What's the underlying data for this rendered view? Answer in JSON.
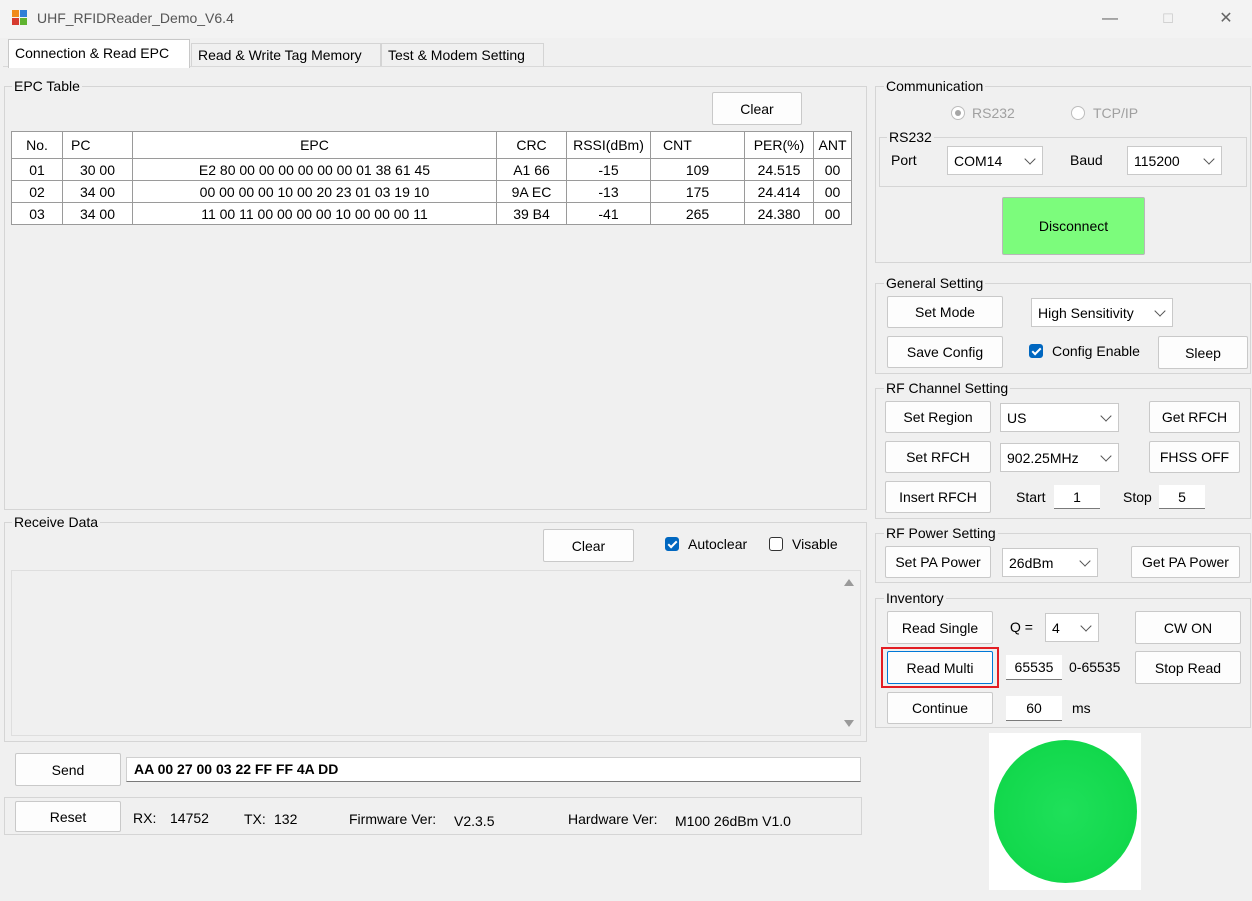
{
  "window": {
    "title": "UHF_RFIDReader_Demo_V6.4",
    "controls": [
      "—",
      "☐",
      "✕"
    ]
  },
  "tabs": [
    "Connection & Read EPC",
    "Read & Write Tag Memory",
    "Test & Modem Setting"
  ],
  "epc_table": {
    "group_label": "EPC Table",
    "clear_label": "Clear",
    "columns": [
      "No.",
      "PC",
      "EPC",
      "CRC",
      "RSSI(dBm)",
      "CNT",
      "PER(%)",
      "ANT"
    ],
    "rows": [
      [
        "01",
        "30 00",
        "E2 80 00 00 00 00 00 00 01 38 61 45",
        "A1 66",
        "-15",
        "109",
        "24.515",
        "00"
      ],
      [
        "02",
        "34 00",
        "00 00 00 00 10 00 20 23 01 03 19 10",
        "9A EC",
        "-13",
        "175",
        "24.414",
        "00"
      ],
      [
        "03",
        "34 00",
        "11 00 11 00 00 00 00 10 00 00 00 11",
        "39 B4",
        "-41",
        "265",
        "24.380",
        "00"
      ]
    ]
  },
  "receive": {
    "group_label": "Receive Data",
    "clear_label": "Clear",
    "autoclear_label": "Autoclear",
    "visable_label": "Visable",
    "autoclear_checked": true,
    "visable_checked": false,
    "send_label": "Send",
    "send_value": "AA 00 27 00 03 22 FF FF 4A DD"
  },
  "status": {
    "reset_label": "Reset",
    "rx_label": "RX:",
    "rx_value": "14752",
    "tx_label": "TX:",
    "tx_value": "132",
    "fw_label": "Firmware Ver:",
    "fw_value": "V2.3.5",
    "hw_label": "Hardware Ver:",
    "hw_value": "M100 26dBm V1.0"
  },
  "communication": {
    "group_label": "Communication",
    "radio_rs232": "RS232",
    "radio_tcpip": "TCP/IP",
    "selected": "RS232",
    "rs232_label": "RS232",
    "port_label": "Port",
    "port_value": "COM14",
    "baud_label": "Baud",
    "baud_value": "115200",
    "disconnect_label": "Disconnect",
    "disconnect_color": "#7cfc7c"
  },
  "general": {
    "group_label": "General Setting",
    "set_mode_label": "Set Mode",
    "mode_value": "High Sensitivity",
    "save_config_label": "Save Config",
    "config_enable_label": "Config Enable",
    "config_enable_checked": true,
    "sleep_label": "Sleep"
  },
  "rf_channel": {
    "group_label": "RF Channel Setting",
    "set_region_label": "Set Region",
    "region_value": "US",
    "get_rfch_label": "Get RFCH",
    "set_rfch_label": "Set RFCH",
    "rfch_value": "902.25MHz",
    "fhss_label": "FHSS OFF",
    "insert_rfch_label": "Insert RFCH",
    "start_label": "Start",
    "start_value": "1",
    "stop_label": "Stop",
    "stop_value": "5"
  },
  "rf_power": {
    "group_label": "RF Power Setting",
    "set_pa_label": "Set PA Power",
    "pa_value": "26dBm",
    "get_pa_label": "Get PA Power"
  },
  "inventory": {
    "group_label": "Inventory",
    "read_single_label": "Read Single",
    "q_label": "Q =",
    "q_value": "4",
    "cw_on_label": "CW ON",
    "read_multi_label": "Read Multi",
    "count_value": "65535",
    "count_range": "0-65535",
    "stop_read_label": "Stop Read",
    "continue_label": "Continue",
    "interval_value": "60",
    "interval_unit": "ms"
  },
  "colors": {
    "indicator": "#12d84c",
    "highlight": "#e31e24",
    "check_accent": "#0067c0"
  }
}
